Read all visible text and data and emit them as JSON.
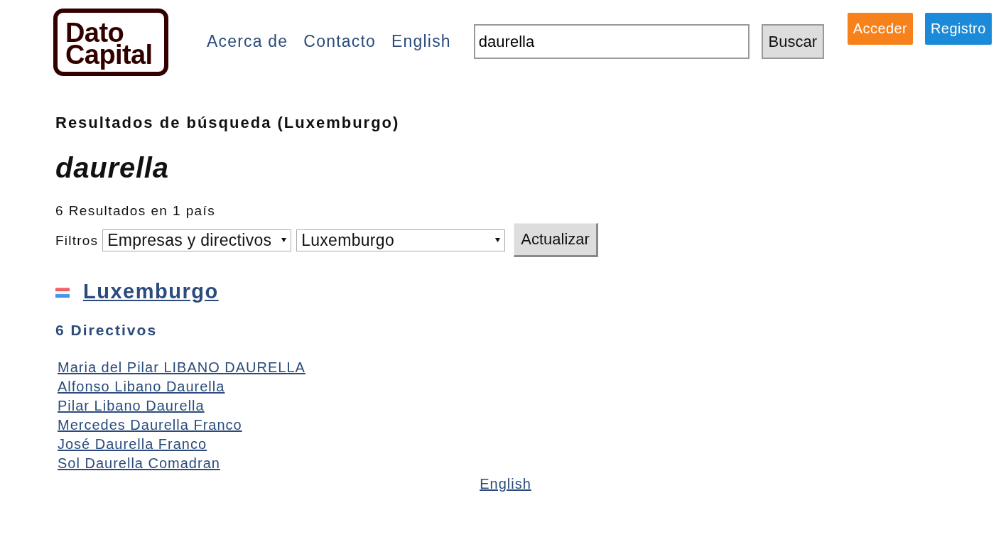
{
  "header": {
    "logo": {
      "lines": [
        "Dato",
        "Capital"
      ]
    },
    "nav_links": [
      "Acerca de",
      "Contacto",
      "English"
    ],
    "search": {
      "value": "daurella",
      "button": "Buscar"
    },
    "auth_buttons": [
      {
        "label": "Acceder",
        "color": "#f7821b"
      },
      {
        "label": "Registro",
        "color": "#1b8ad9"
      }
    ]
  },
  "results": {
    "heading": "Resultados de búsqueda (Luxemburgo)",
    "query": "daurella",
    "summary": "6 Resultados en 1 país",
    "filters": {
      "label": "Filtros",
      "selects": [
        "Empresas y directivos",
        "Luxemburgo"
      ],
      "button": "Actualizar"
    },
    "country": {
      "name": "Luxemburgo",
      "section_title": "6 Directivos",
      "people": [
        "Maria del Pilar LIBANO DAURELLA",
        "Alfonso Libano Daurella",
        "Pilar Libano Daurella",
        "Mercedes Daurella Franco",
        "José Daurella Franco",
        "Sol Daurella Comadran"
      ]
    }
  },
  "footer": {
    "language_link": "English"
  }
}
